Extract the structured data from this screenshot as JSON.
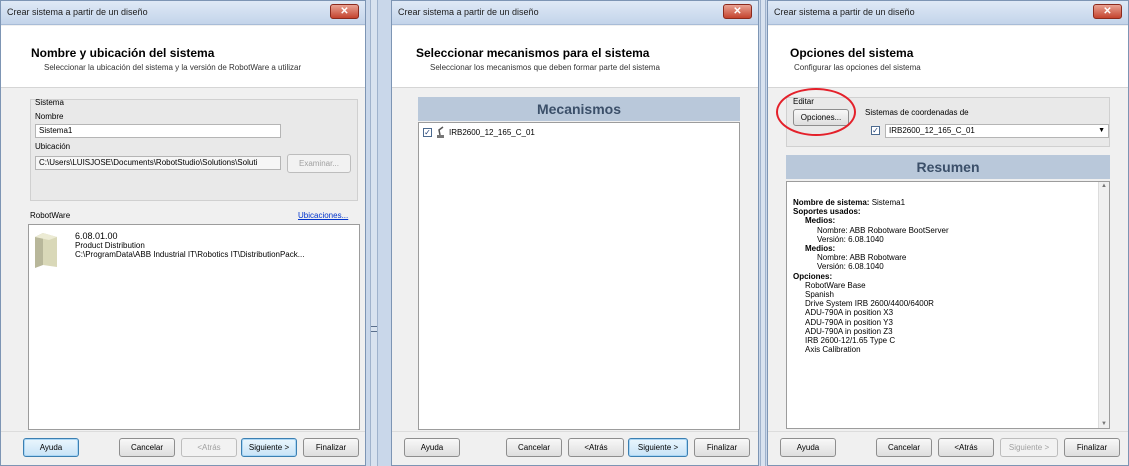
{
  "window_title": "Crear sistema a partir de un diseño",
  "close_glyph": "✕",
  "dialog1": {
    "header_title": "Nombre y ubicación del sistema",
    "header_subtitle": "Seleccionar la ubicación del sistema y la versión de RobotWare a utilizar",
    "group_label": "Sistema",
    "name_label": "Nombre",
    "name_value": "Sistema1",
    "location_label": "Ubicación",
    "location_value": "C:\\Users\\LUISJOSE\\Documents\\RobotStudio\\Solutions\\Soluti",
    "browse_button": "Examinar...",
    "robotware_label": "RobotWare",
    "locations_link": "Ubicaciones...",
    "robotware_item": {
      "version": "6.08.01.00",
      "distribution": "Product Distribution",
      "path": "C:\\ProgramData\\ABB Industrial IT\\Robotics IT\\DistributionPack..."
    },
    "buttons": {
      "help": "Ayuda",
      "cancel": "Cancelar",
      "back": "<Atrás",
      "next": "Siguiente >",
      "finish": "Finalizar"
    }
  },
  "dialog2": {
    "header_title": "Seleccionar mecanismos para el sistema",
    "header_subtitle": "Seleccionar los mecanismos que deben formar parte del sistema",
    "band_title": "Mecanismos",
    "mechanism": "IRB2600_12_165_C_01",
    "buttons": {
      "help": "Ayuda",
      "cancel": "Cancelar",
      "back": "<Atrás",
      "next": "Siguiente >",
      "finish": "Finalizar"
    }
  },
  "dialog3": {
    "header_title": "Opciones del sistema",
    "header_subtitle": "Configurar las opciones del sistema",
    "edit_label": "Editar",
    "options_button": "Opciones...",
    "coord_label": "Sistemas de coordenadas de",
    "coord_value": "IRB2600_12_165_C_01",
    "band_title": "Resumen",
    "summary": [
      {
        "text": "Nombre de sistema:",
        "value": "Sistema1",
        "indent": 0,
        "bold": true
      },
      {
        "text": "Soportes usados:",
        "value": "",
        "indent": 0,
        "bold": true
      },
      {
        "text": "Medios:",
        "value": "",
        "indent": 1,
        "bold": true
      },
      {
        "text": "Nombre: ABB Robotware BootServer",
        "value": "",
        "indent": 2,
        "bold": false
      },
      {
        "text": "Versión: 6.08.1040",
        "value": "",
        "indent": 2,
        "bold": false
      },
      {
        "text": "Medios:",
        "value": "",
        "indent": 1,
        "bold": true
      },
      {
        "text": "Nombre: ABB Robotware",
        "value": "",
        "indent": 2,
        "bold": false
      },
      {
        "text": "Versión: 6.08.1040",
        "value": "",
        "indent": 2,
        "bold": false
      },
      {
        "text": "Opciones:",
        "value": "",
        "indent": 0,
        "bold": true
      },
      {
        "text": "RobotWare Base",
        "value": "",
        "indent": 1,
        "bold": false
      },
      {
        "text": "Spanish",
        "value": "",
        "indent": 1,
        "bold": false
      },
      {
        "text": "Drive System IRB 2600/4400/6400R",
        "value": "",
        "indent": 1,
        "bold": false
      },
      {
        "text": "ADU-790A in position X3",
        "value": "",
        "indent": 1,
        "bold": false
      },
      {
        "text": "ADU-790A in position Y3",
        "value": "",
        "indent": 1,
        "bold": false
      },
      {
        "text": "ADU-790A in position Z3",
        "value": "",
        "indent": 1,
        "bold": false
      },
      {
        "text": "IRB 2600-12/1.65 Type C",
        "value": "",
        "indent": 1,
        "bold": false
      },
      {
        "text": "Axis Calibration",
        "value": "",
        "indent": 1,
        "bold": false
      }
    ],
    "buttons": {
      "help": "Ayuda",
      "cancel": "Cancelar",
      "back": "<Atrás",
      "next": "Siguiente >",
      "finish": "Finalizar"
    }
  }
}
